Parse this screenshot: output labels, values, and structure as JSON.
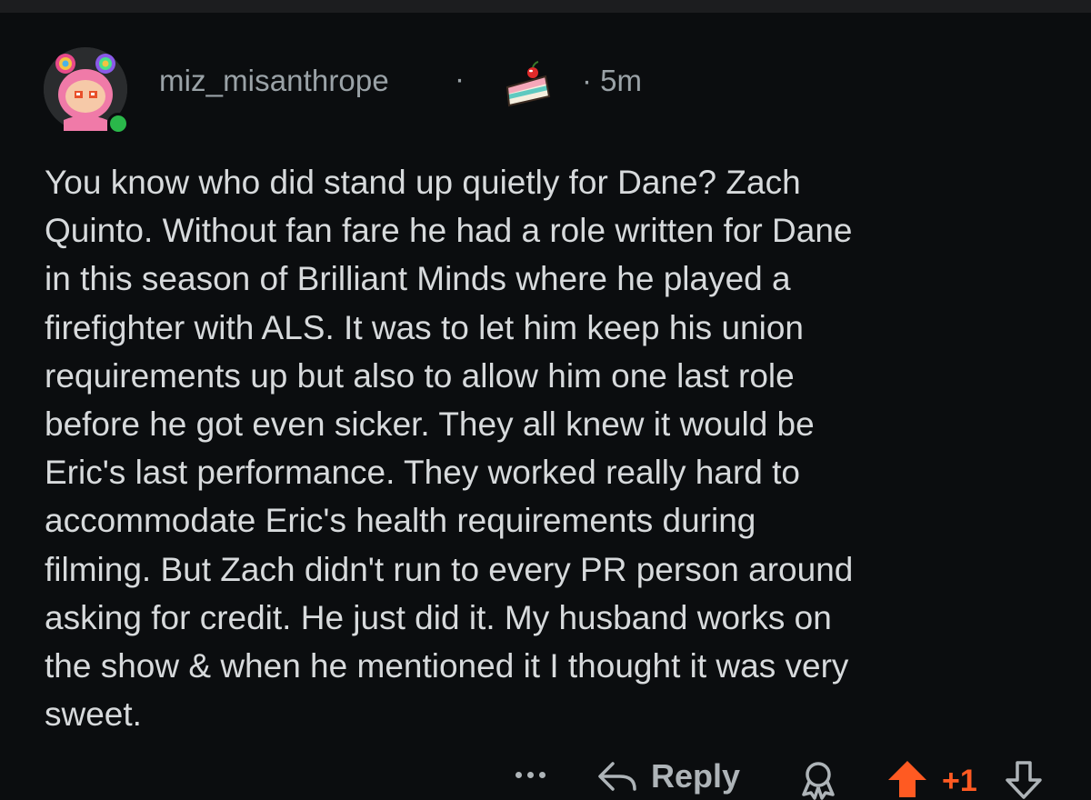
{
  "comment": {
    "username": "miz_misanthrope",
    "separator": "·",
    "timestamp_sep": "· 5m",
    "body": "You know who did stand up quietly for Dane? Zach\nQuinto. Without fan fare he had a role written for Dane\nin this season of Brilliant Minds where he played a\nfirefighter with ALS. It was to let him keep his union\nrequirements up but also to allow him one last role\nbefore he got even sicker. They all knew it would be\nEric's last performance. They worked really hard to\naccommodate Eric's health requirements during\nfilming. But Zach didn't run to every PR person around\nasking for credit. He just did it.  My husband works on\nthe show & when he mentioned it I thought it was very\nsweet.",
    "online": true
  },
  "actions": {
    "reply_label": "Reply",
    "score": "+1",
    "vote_state": "upvoted"
  },
  "icons": {
    "more": "more-dots-icon",
    "reply": "reply-arrow-icon",
    "award": "award-icon",
    "upvote": "upvote-arrow-icon",
    "downvote": "downvote-arrow-icon",
    "cake": "cake-day-icon"
  },
  "colors": {
    "background": "#0b0d0f",
    "text": "#d7dadc",
    "meta": "#9aa2a7",
    "upvote_accent": "#ff5a22",
    "online_dot": "#2ab84a"
  }
}
